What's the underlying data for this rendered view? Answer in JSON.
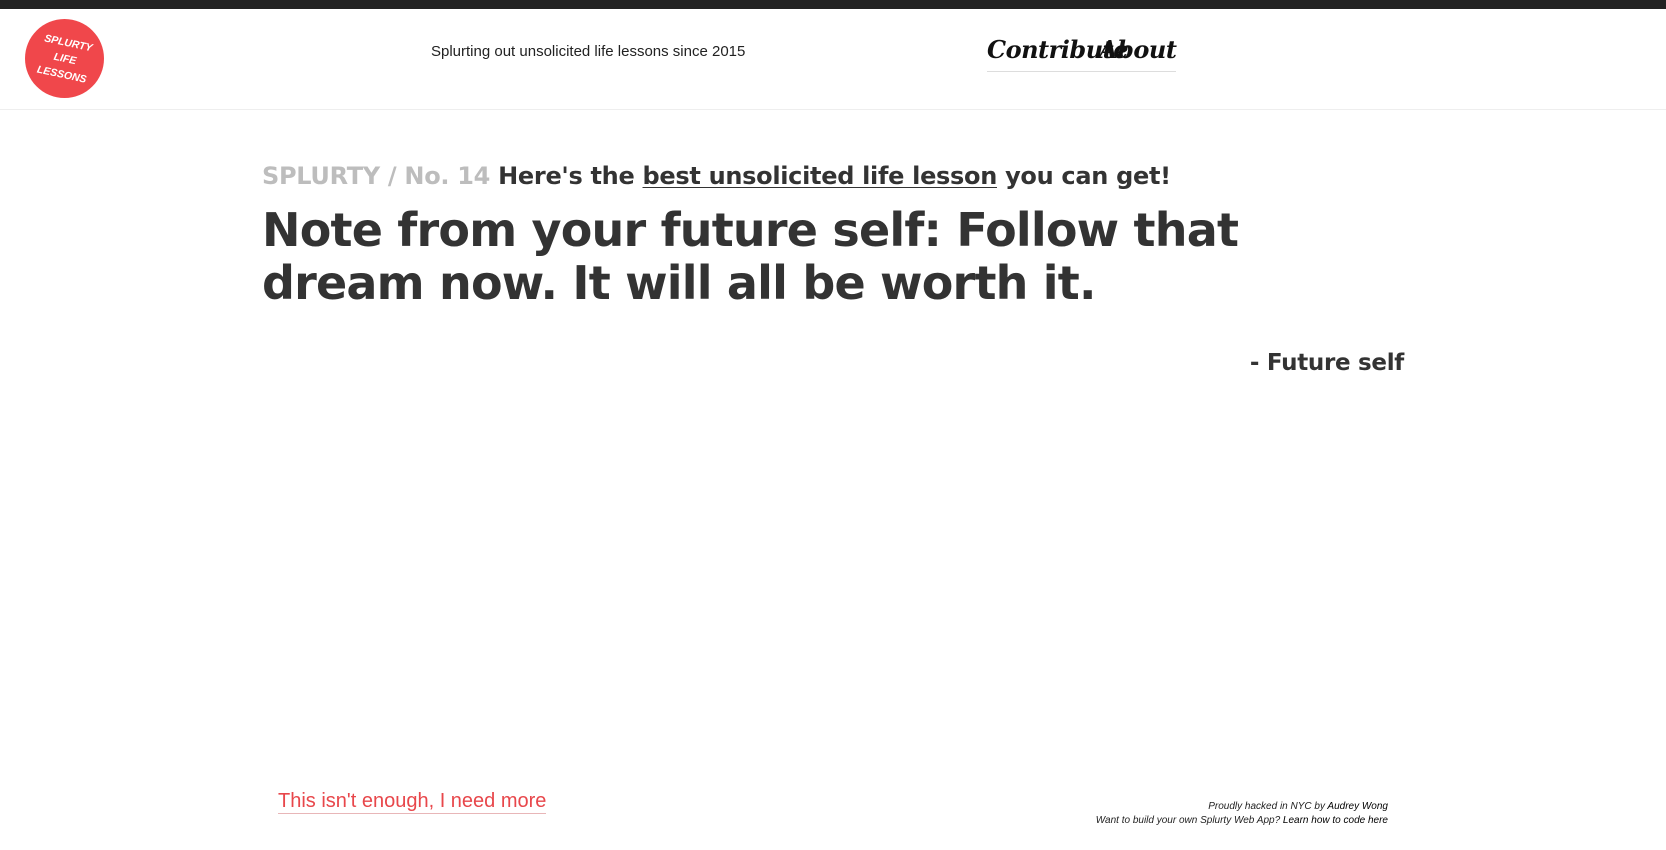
{
  "header": {
    "logo_lines": [
      "SPLURTY",
      "LIFE",
      "LESSONS"
    ],
    "tagline": "Splurting out unsolicited life lessons since 2015",
    "nav": {
      "contribute": "Contribute",
      "about": "About"
    }
  },
  "main": {
    "kicker_prefix": "SPLURTY / No. 14",
    "kicker_before": "Here's the",
    "kicker_link": "best unsolicited life lesson",
    "kicker_after": "you can get!",
    "lesson": "Note from your future self: Follow that dream now. It will all be worth it.",
    "author": "- Future self"
  },
  "footer": {
    "more_link": "This isn't enough, I need more",
    "credit_line1_prefix": "Proudly hacked in NYC by",
    "credit_line1_link": "Audrey Wong",
    "credit_line2_prefix": "Want to build your own Splurty Web App?",
    "credit_line2_link": "Learn how to code here"
  },
  "colors": {
    "brand_red": "#f0474b",
    "text_dark": "#333333",
    "text_muted": "#bdbdbd",
    "topbar": "#222222"
  }
}
